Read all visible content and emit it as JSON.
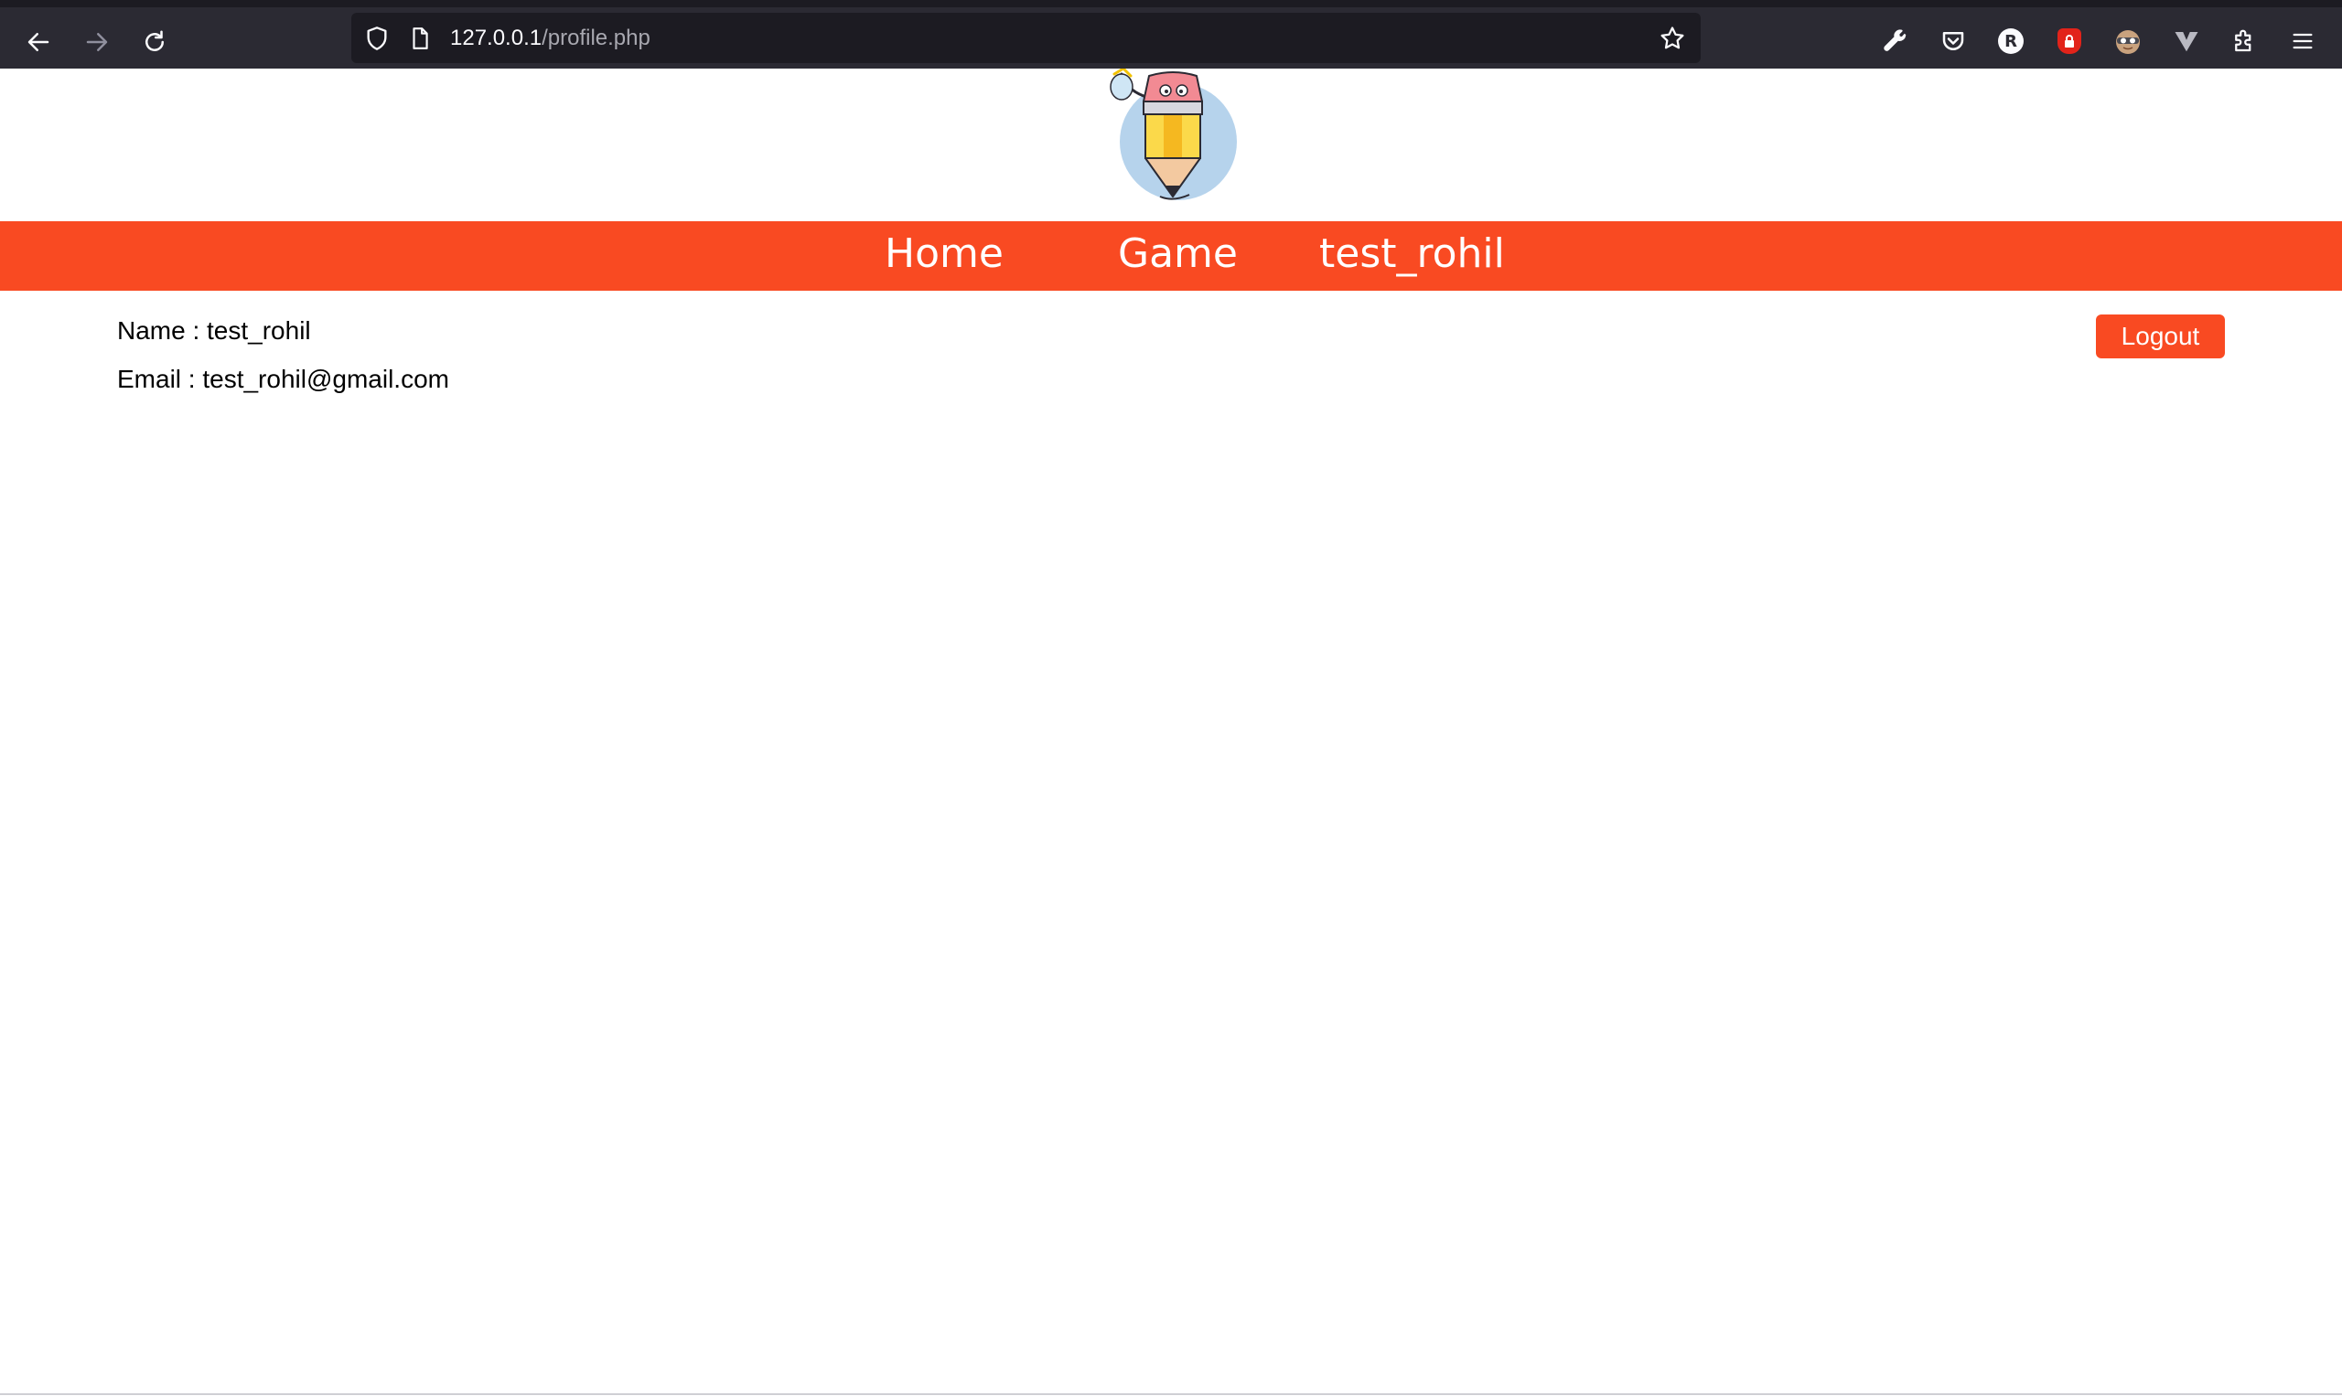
{
  "browser": {
    "url_host": "127.0.0.1",
    "url_path": "/profile.php",
    "icons": [
      "back-arrow-icon",
      "forward-arrow-icon",
      "reload-icon",
      "shield-icon",
      "page-icon",
      "star-icon",
      "wrench-icon",
      "pocket-icon",
      "r-extension-icon",
      "red-lock-extension-icon",
      "mask-extension-icon",
      "v-extension-icon",
      "extensions-puzzle-icon",
      "hamburger-menu-icon"
    ],
    "r_extension_letter": "R"
  },
  "site": {
    "nav": {
      "home": "Home",
      "game": "Game",
      "user": "test_rohil"
    },
    "accent_color": "#f94a22"
  },
  "profile": {
    "name_line": "Name : test_rohil",
    "email_line": "Email : test_rohil@gmail.com",
    "logout_label": "Logout"
  }
}
